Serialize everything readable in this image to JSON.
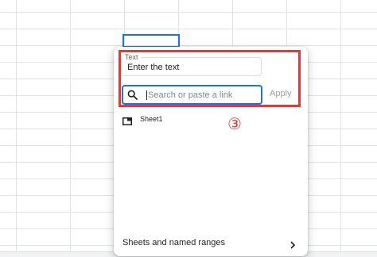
{
  "dialog": {
    "text_field": {
      "label": "Text",
      "value": "Enter the text"
    },
    "link_search": {
      "placeholder": "Search or paste a link",
      "icon": "search-icon"
    },
    "apply_label": "Apply",
    "sheet_items": [
      {
        "label": "Sheet1",
        "icon": "sheet-tab-icon"
      }
    ],
    "sheets_and_ranges_label": "Sheets and named ranges",
    "annotation_step": "③"
  },
  "colors": {
    "accent": "#1a73e8",
    "highlight": "#e53935",
    "disabled_text": "#9aa0a6"
  }
}
